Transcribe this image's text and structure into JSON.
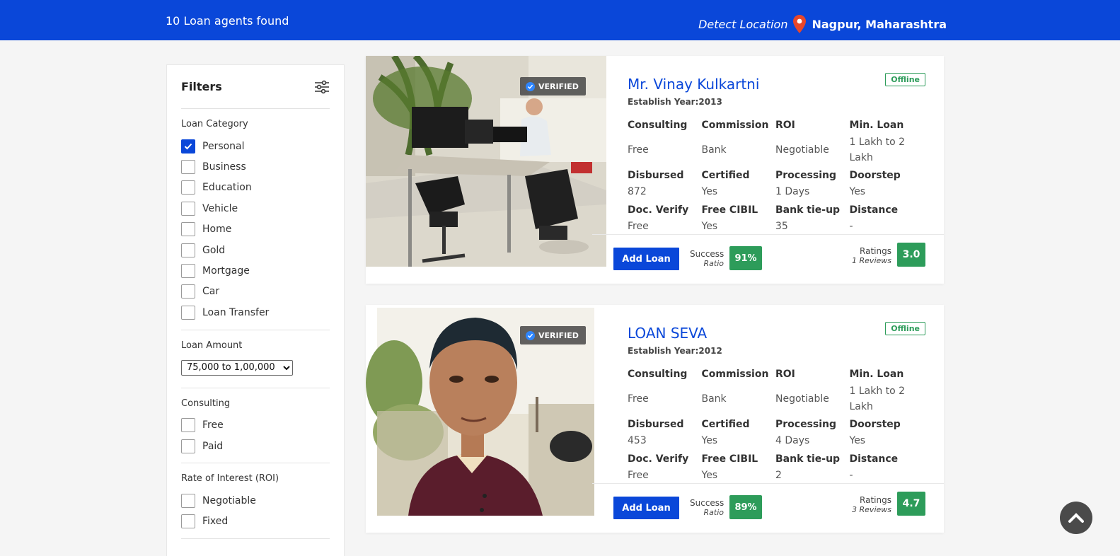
{
  "header": {
    "results_text": "10 Loan agents found",
    "detect_label": "Detect Location",
    "city": "Nagpur, Maharashtra"
  },
  "filters": {
    "title": "Filters",
    "loan_category": {
      "title": "Loan Category",
      "options": [
        {
          "label": "Personal",
          "checked": true
        },
        {
          "label": "Business",
          "checked": false
        },
        {
          "label": "Education",
          "checked": false
        },
        {
          "label": "Vehicle",
          "checked": false
        },
        {
          "label": "Home",
          "checked": false
        },
        {
          "label": "Gold",
          "checked": false
        },
        {
          "label": "Mortgage",
          "checked": false
        },
        {
          "label": "Car",
          "checked": false
        },
        {
          "label": "Loan Transfer",
          "checked": false
        }
      ]
    },
    "loan_amount": {
      "title": "Loan Amount",
      "selected": "75,000 to 1,00,000"
    },
    "consulting": {
      "title": "Consulting",
      "options": [
        {
          "label": "Free",
          "checked": false
        },
        {
          "label": "Paid",
          "checked": false
        }
      ]
    },
    "roi": {
      "title": "Rate of Interest (ROI)",
      "options": [
        {
          "label": "Negotiable",
          "checked": false
        },
        {
          "label": "Fixed",
          "checked": false
        }
      ]
    }
  },
  "common": {
    "verified": "VERIFIED",
    "labels": {
      "consulting": "Consulting",
      "commission": "Commission",
      "roi": "ROI",
      "min_loan": "Min. Loan",
      "disbursed": "Disbursed",
      "certified": "Certified",
      "processing": "Processing",
      "doorstep": "Doorstep",
      "doc_verify": "Doc. Verify",
      "free_cibil": "Free CIBIL",
      "bank_tieup": "Bank tie-up",
      "distance": "Distance"
    },
    "add_loan": "Add Loan",
    "success": "Success",
    "ratio": "Ratio",
    "ratings": "Ratings"
  },
  "agents": [
    {
      "name": "Mr. Vinay Kulkartni",
      "established": "Establish Year:2013",
      "status": "Offline",
      "consulting": "Free",
      "commission": "Bank",
      "roi": "Negotiable",
      "min_loan": "1 Lakh to 2 Lakh",
      "disbursed": "872",
      "certified": "Yes",
      "processing": "1 Days",
      "doorstep": "Yes",
      "doc_verify": "Free",
      "free_cibil": "Yes",
      "bank_tieup": "35",
      "distance": "-",
      "success_ratio": "91%",
      "reviews": "1 Reviews",
      "rating": "3.0"
    },
    {
      "name": "LOAN SEVA",
      "established": "Establish Year:2012",
      "status": "Offline",
      "consulting": "Free",
      "commission": "Bank",
      "roi": "Negotiable",
      "min_loan": "1 Lakh to 2 Lakh",
      "disbursed": "453",
      "certified": "Yes",
      "processing": "4 Days",
      "doorstep": "Yes",
      "doc_verify": "Free",
      "free_cibil": "Yes",
      "bank_tieup": "2",
      "distance": "-",
      "success_ratio": "89%",
      "reviews": "3 Reviews",
      "rating": "4.7"
    }
  ]
}
